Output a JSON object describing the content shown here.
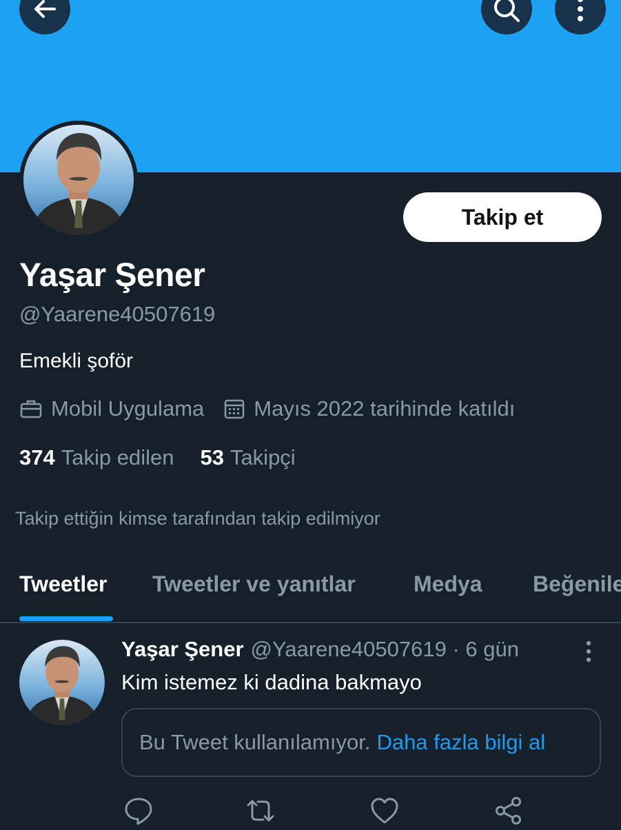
{
  "header": {
    "banner_color": "#1da1f2",
    "back_icon": "arrow-left-icon",
    "search_icon": "search-icon",
    "more_icon": "more-vertical-icon"
  },
  "profile": {
    "name": "Yaşar Şener",
    "handle": "@Yaarene40507619",
    "bio": "Emekli şoför",
    "follow_label": "Takip et",
    "meta": {
      "app_icon": "briefcase-icon",
      "app_label": "Mobil Uygulama",
      "joined_icon": "calendar-icon",
      "joined_label": "Mayıs 2022 tarihinde katıldı"
    },
    "following_count": "374",
    "following_label": "Takip edilen",
    "followers_count": "53",
    "followers_label": "Takipçi",
    "followed_by_notice": "Takip ettiğin kimse tarafından takip edilmiyor"
  },
  "tabs": [
    {
      "label": "Tweetler",
      "active": true
    },
    {
      "label": "Tweetler ve yanıtlar",
      "active": false
    },
    {
      "label": "Medya",
      "active": false
    },
    {
      "label": "Beğeniler",
      "active": false
    }
  ],
  "tweet": {
    "name": "Yaşar Şener",
    "handle": "@Yaarene40507619",
    "separator": "·",
    "time": "6 gün",
    "text": "Kim istemez ki dadina bakmayo",
    "unavailable_text": "Bu Tweet kullanılamıyor.",
    "unavailable_link": "Daha fazla bilgi al",
    "actions": [
      "reply-icon",
      "retweet-icon",
      "like-icon",
      "share-icon"
    ]
  },
  "colors": {
    "background": "#15202b",
    "accent": "#1da1f2",
    "secondary_text": "#8b98a5",
    "border": "#38444d"
  }
}
